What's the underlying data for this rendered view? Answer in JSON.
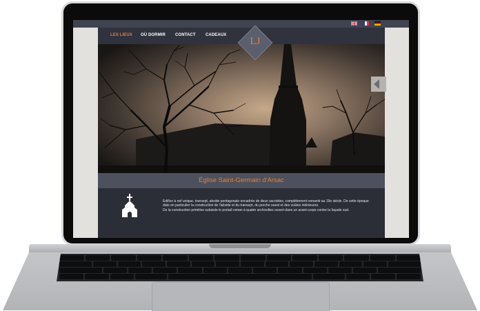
{
  "flags": [
    {
      "name": "english-flag",
      "lang": "en"
    },
    {
      "name": "french-flag",
      "lang": "fr"
    },
    {
      "name": "german-flag",
      "lang": "de"
    }
  ],
  "nav": {
    "items": [
      "LES LIEUX",
      "OÙ DORMIR",
      "CONTACT",
      "CADEAUX"
    ],
    "active_index": 0
  },
  "logo": {
    "text": "LJ"
  },
  "place": {
    "title": "Église Saint-Germain d'Arsac",
    "icon": "church-icon",
    "description": [
      "Edifice à nef unique, transept, abside pentagonale encadrée de deux sacristies, complètement remanié au 19e siècle. De cette époque date en particulier la construction de l'abside et du transept, du porche ouest et des voûtes intérieures.",
      "De la construction primitive subsiste le portail roman à quatre archivoltes ouvert dans un avant-corps contre la façade sud."
    ]
  },
  "colors": {
    "accent": "#e0823c",
    "nav_bg": "#30323e",
    "title_bar_bg": "#4d505d",
    "content_bg": "#2b2d37"
  }
}
